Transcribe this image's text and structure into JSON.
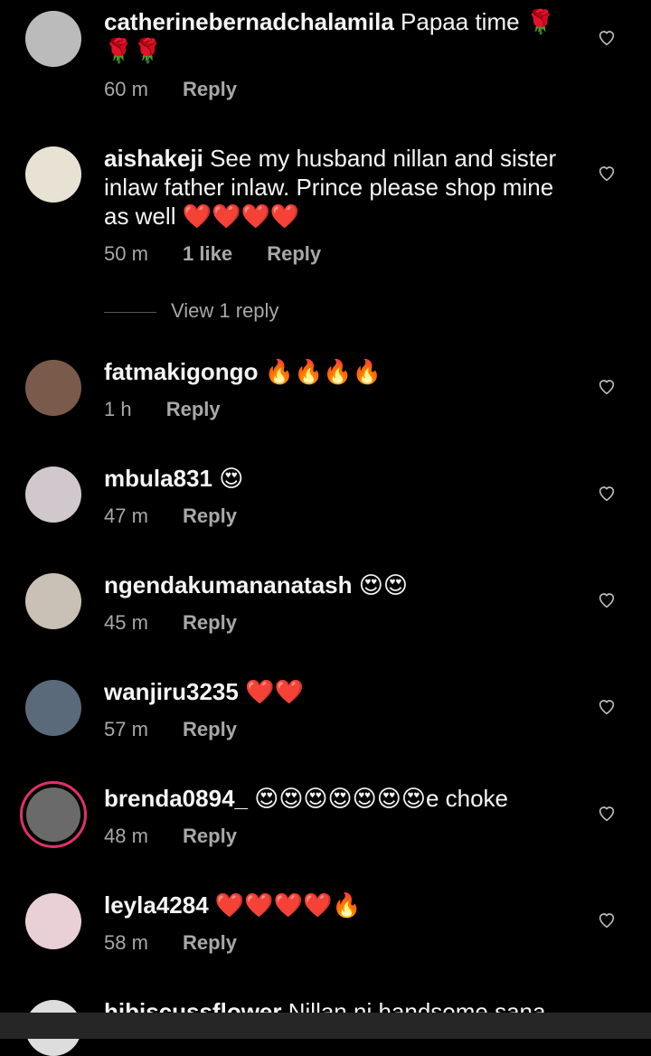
{
  "comments": [
    {
      "username": "catherinebernadchalamila",
      "text": "Papaa time 🌹🌹🌹",
      "time": "60 m",
      "likes": "",
      "reply": "Reply"
    },
    {
      "username": "aishakeji",
      "text": "See my husband nillan and  sister inlaw father inlaw. Prince please shop mine as well ❤️❤️❤️❤️",
      "time": "50 m",
      "likes": "1 like",
      "reply": "Reply"
    },
    {
      "username": "fatmakigongo",
      "text": "🔥🔥🔥🔥",
      "time": "1 h",
      "likes": "",
      "reply": "Reply"
    },
    {
      "username": "mbula831",
      "text": "😍",
      "time": "47 m",
      "likes": "",
      "reply": "Reply"
    },
    {
      "username": "ngendakumananatash",
      "text": "😍😍",
      "time": "45 m",
      "likes": "",
      "reply": "Reply"
    },
    {
      "username": "wanjiru3235",
      "text": "❤️❤️",
      "time": "57 m",
      "likes": "",
      "reply": "Reply"
    },
    {
      "username": "brenda0894_",
      "text": "😍😍😍😍😍😍😍e choke",
      "time": "48 m",
      "likes": "",
      "reply": "Reply"
    },
    {
      "username": "leyla4284",
      "text": "❤️❤️❤️❤️🔥",
      "time": "58 m",
      "likes": "",
      "reply": "Reply"
    },
    {
      "username": "hibiscussflower",
      "text": "Nillan ni handsome sana",
      "time": "",
      "likes": "",
      "reply": ""
    }
  ],
  "view_replies": "View 1 reply",
  "icons": {
    "like": "heart-outline-icon"
  },
  "colors": {
    "background": "#000000",
    "secondary_text": "#a8a8a8",
    "story_ring": "#e1306c"
  }
}
